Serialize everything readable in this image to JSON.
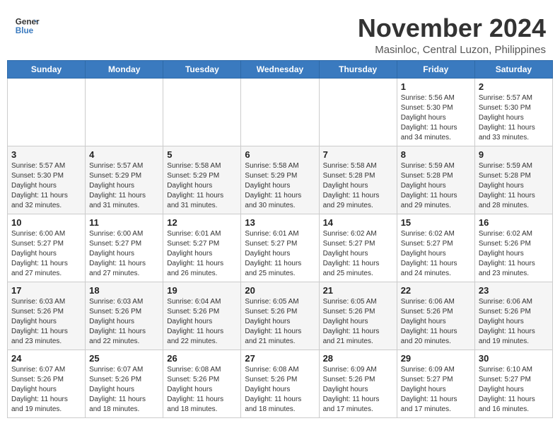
{
  "logo": {
    "general": "General",
    "blue": "Blue"
  },
  "title": {
    "month_year": "November 2024",
    "location": "Masinloc, Central Luzon, Philippines"
  },
  "weekdays": [
    "Sunday",
    "Monday",
    "Tuesday",
    "Wednesday",
    "Thursday",
    "Friday",
    "Saturday"
  ],
  "weeks": [
    [
      {
        "day": "",
        "info": ""
      },
      {
        "day": "",
        "info": ""
      },
      {
        "day": "",
        "info": ""
      },
      {
        "day": "",
        "info": ""
      },
      {
        "day": "",
        "info": ""
      },
      {
        "day": "1",
        "info": "Sunrise: 5:56 AM\nSunset: 5:30 PM\nDaylight: 11 hours\nand 34 minutes."
      },
      {
        "day": "2",
        "info": "Sunrise: 5:57 AM\nSunset: 5:30 PM\nDaylight: 11 hours\nand 33 minutes."
      }
    ],
    [
      {
        "day": "3",
        "info": "Sunrise: 5:57 AM\nSunset: 5:30 PM\nDaylight: 11 hours\nand 32 minutes."
      },
      {
        "day": "4",
        "info": "Sunrise: 5:57 AM\nSunset: 5:29 PM\nDaylight: 11 hours\nand 31 minutes."
      },
      {
        "day": "5",
        "info": "Sunrise: 5:58 AM\nSunset: 5:29 PM\nDaylight: 11 hours\nand 31 minutes."
      },
      {
        "day": "6",
        "info": "Sunrise: 5:58 AM\nSunset: 5:29 PM\nDaylight: 11 hours\nand 30 minutes."
      },
      {
        "day": "7",
        "info": "Sunrise: 5:58 AM\nSunset: 5:28 PM\nDaylight: 11 hours\nand 29 minutes."
      },
      {
        "day": "8",
        "info": "Sunrise: 5:59 AM\nSunset: 5:28 PM\nDaylight: 11 hours\nand 29 minutes."
      },
      {
        "day": "9",
        "info": "Sunrise: 5:59 AM\nSunset: 5:28 PM\nDaylight: 11 hours\nand 28 minutes."
      }
    ],
    [
      {
        "day": "10",
        "info": "Sunrise: 6:00 AM\nSunset: 5:27 PM\nDaylight: 11 hours\nand 27 minutes."
      },
      {
        "day": "11",
        "info": "Sunrise: 6:00 AM\nSunset: 5:27 PM\nDaylight: 11 hours\nand 27 minutes."
      },
      {
        "day": "12",
        "info": "Sunrise: 6:01 AM\nSunset: 5:27 PM\nDaylight: 11 hours\nand 26 minutes."
      },
      {
        "day": "13",
        "info": "Sunrise: 6:01 AM\nSunset: 5:27 PM\nDaylight: 11 hours\nand 25 minutes."
      },
      {
        "day": "14",
        "info": "Sunrise: 6:02 AM\nSunset: 5:27 PM\nDaylight: 11 hours\nand 25 minutes."
      },
      {
        "day": "15",
        "info": "Sunrise: 6:02 AM\nSunset: 5:27 PM\nDaylight: 11 hours\nand 24 minutes."
      },
      {
        "day": "16",
        "info": "Sunrise: 6:02 AM\nSunset: 5:26 PM\nDaylight: 11 hours\nand 23 minutes."
      }
    ],
    [
      {
        "day": "17",
        "info": "Sunrise: 6:03 AM\nSunset: 5:26 PM\nDaylight: 11 hours\nand 23 minutes."
      },
      {
        "day": "18",
        "info": "Sunrise: 6:03 AM\nSunset: 5:26 PM\nDaylight: 11 hours\nand 22 minutes."
      },
      {
        "day": "19",
        "info": "Sunrise: 6:04 AM\nSunset: 5:26 PM\nDaylight: 11 hours\nand 22 minutes."
      },
      {
        "day": "20",
        "info": "Sunrise: 6:05 AM\nSunset: 5:26 PM\nDaylight: 11 hours\nand 21 minutes."
      },
      {
        "day": "21",
        "info": "Sunrise: 6:05 AM\nSunset: 5:26 PM\nDaylight: 11 hours\nand 21 minutes."
      },
      {
        "day": "22",
        "info": "Sunrise: 6:06 AM\nSunset: 5:26 PM\nDaylight: 11 hours\nand 20 minutes."
      },
      {
        "day": "23",
        "info": "Sunrise: 6:06 AM\nSunset: 5:26 PM\nDaylight: 11 hours\nand 19 minutes."
      }
    ],
    [
      {
        "day": "24",
        "info": "Sunrise: 6:07 AM\nSunset: 5:26 PM\nDaylight: 11 hours\nand 19 minutes."
      },
      {
        "day": "25",
        "info": "Sunrise: 6:07 AM\nSunset: 5:26 PM\nDaylight: 11 hours\nand 18 minutes."
      },
      {
        "day": "26",
        "info": "Sunrise: 6:08 AM\nSunset: 5:26 PM\nDaylight: 11 hours\nand 18 minutes."
      },
      {
        "day": "27",
        "info": "Sunrise: 6:08 AM\nSunset: 5:26 PM\nDaylight: 11 hours\nand 18 minutes."
      },
      {
        "day": "28",
        "info": "Sunrise: 6:09 AM\nSunset: 5:26 PM\nDaylight: 11 hours\nand 17 minutes."
      },
      {
        "day": "29",
        "info": "Sunrise: 6:09 AM\nSunset: 5:27 PM\nDaylight: 11 hours\nand 17 minutes."
      },
      {
        "day": "30",
        "info": "Sunrise: 6:10 AM\nSunset: 5:27 PM\nDaylight: 11 hours\nand 16 minutes."
      }
    ]
  ]
}
